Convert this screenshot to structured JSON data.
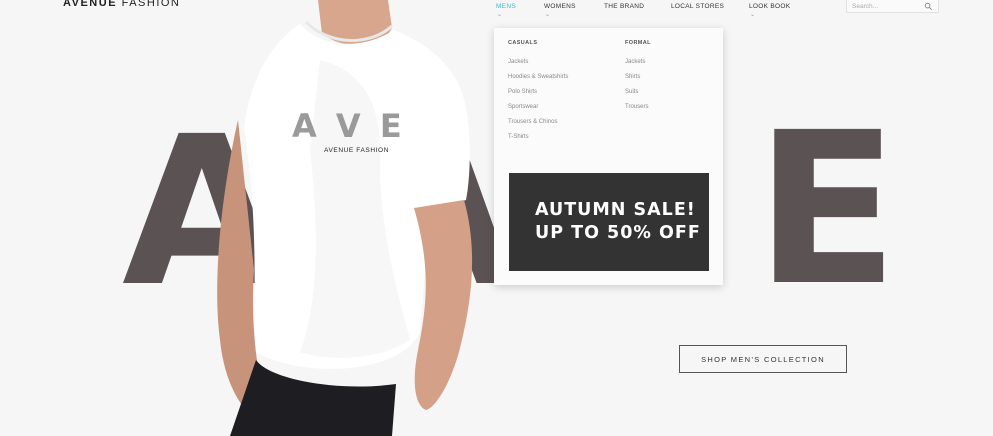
{
  "brand": {
    "bold": "AVENUE",
    "light": "FASHION"
  },
  "nav": {
    "items": [
      {
        "label": "MENS",
        "active": true
      },
      {
        "label": "WOMENS"
      },
      {
        "label": "THE BRAND"
      },
      {
        "label": "LOCAL STORES"
      },
      {
        "label": "LOOK BOOK"
      }
    ]
  },
  "search": {
    "placeholder": "Search..."
  },
  "hero": {
    "letters": [
      "A",
      "V",
      "E"
    ],
    "shirt_print": {
      "letters": "A V E",
      "brand": "AVENUE FASHION"
    }
  },
  "dropdown": {
    "columns": [
      {
        "heading": "CASUALS",
        "links": [
          "Jackets",
          "Hoodies & Sweatshirts",
          "Polo Shirts",
          "Sportswear",
          "Trousers & Chinos",
          "T-Shirts"
        ]
      },
      {
        "heading": "FORMAL",
        "links": [
          "Jackets",
          "Shirts",
          "Suits",
          "Trousers"
        ]
      }
    ],
    "promo": {
      "line1": "AUTUMN SALE!",
      "line2": "UP TO 50% OFF"
    }
  },
  "cta": {
    "label": "SHOP MEN’S COLLECTION"
  },
  "colors": {
    "accent": "#3fb6c9",
    "letters": "#5b5254",
    "promo_bg": "#333333",
    "background": "#f6f6f6"
  }
}
